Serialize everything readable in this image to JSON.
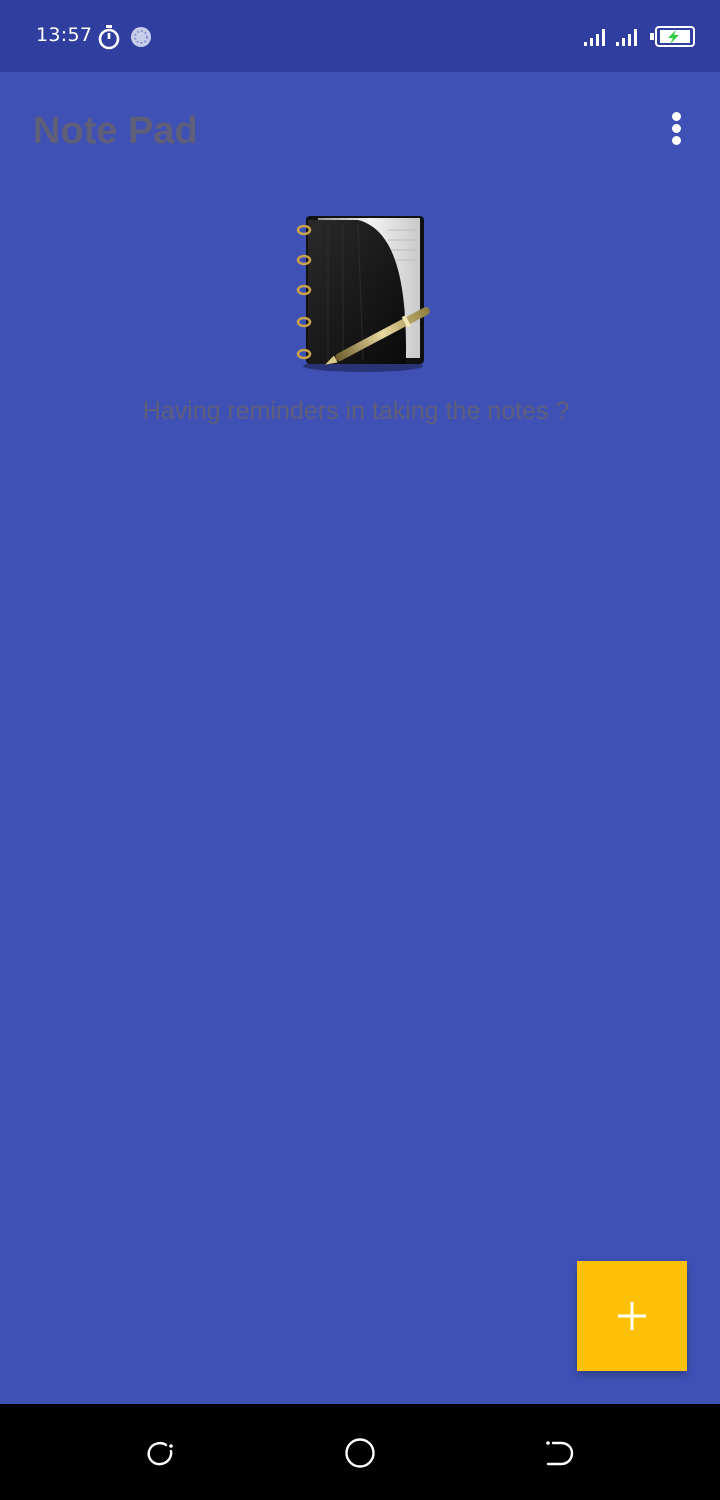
{
  "status_bar": {
    "time": "13:57",
    "icons": [
      "stopwatch-icon",
      "sync-icon",
      "signal-icon",
      "signal-icon",
      "battery-charging-icon"
    ]
  },
  "app_bar": {
    "title": "Note Pad",
    "menu_icon": "more-vert-icon"
  },
  "empty_state": {
    "illustration": "notebook-pen-icon",
    "message": "Having reminders  in taking the notes ?"
  },
  "fab": {
    "icon": "plus-icon",
    "color": "#FFC107"
  },
  "nav_bar": {
    "buttons": [
      "recent-apps-icon",
      "home-icon",
      "back-icon"
    ]
  },
  "colors": {
    "primary": "#3F51B5",
    "primary_dark": "#303F9F",
    "accent": "#FFC107",
    "muted_text": "#5F5F7A"
  }
}
